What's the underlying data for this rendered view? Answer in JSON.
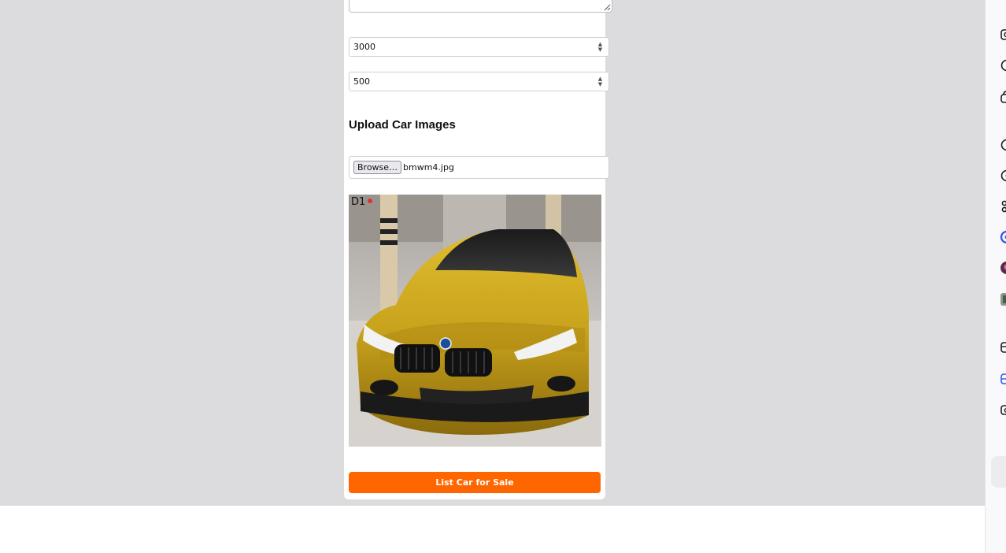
{
  "form": {
    "price_value": "3000",
    "mileage_value": "500",
    "upload_heading": "Upload Car Images",
    "browse_label": "Browse…",
    "file_name": "bmwm4.jpg",
    "preview_badge": "D1",
    "submit_label": "List Car for Sale"
  },
  "colors": {
    "page_bg": "#dcdcde",
    "card_bg": "#ffffff",
    "accent": "#ff6600",
    "car_paint": "#c8a21c"
  },
  "sidebar": {
    "icons": [
      "screenshot-icon",
      "chat-bubble-icon",
      "shopping-bag-icon",
      "clock-icon",
      "help-icon",
      "people-icon",
      "extension-app-icon",
      "profile-avatar-icon",
      "profile-avatar-icon",
      "container-icon",
      "container-active-icon",
      "folder-icon"
    ]
  }
}
